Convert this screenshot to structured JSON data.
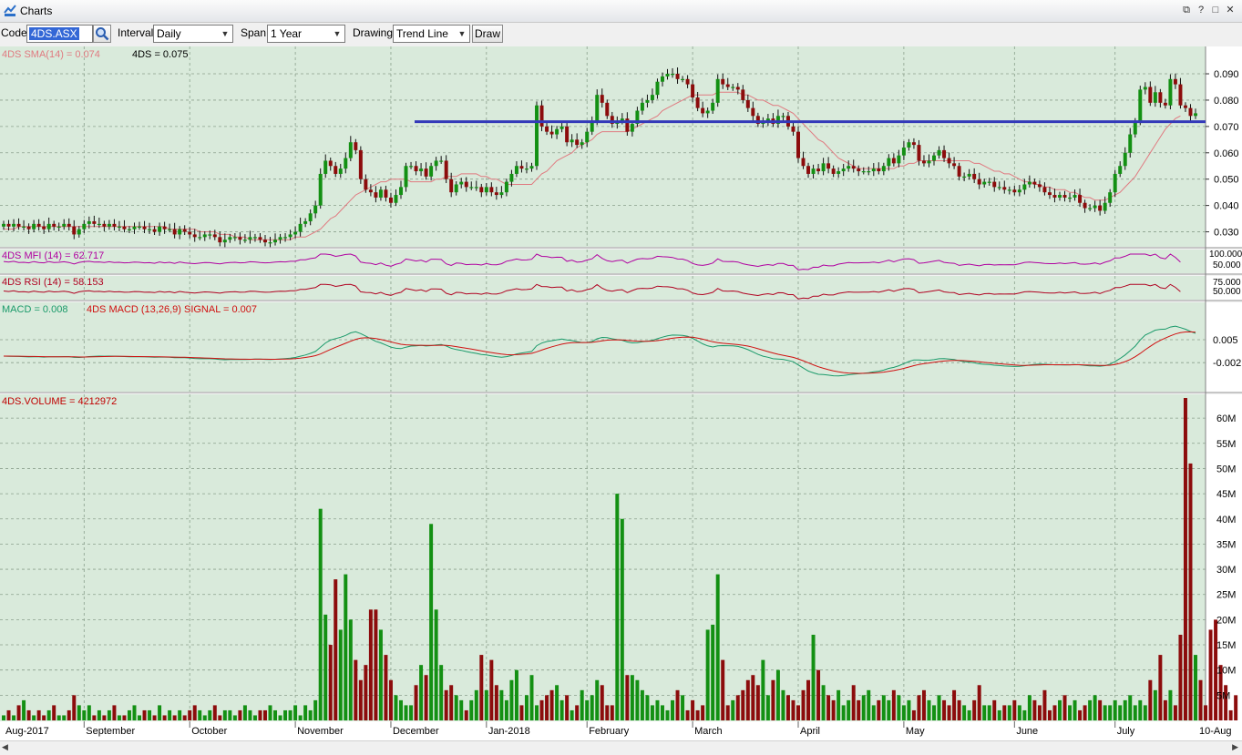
{
  "window": {
    "title": "Charts",
    "controls": [
      "⧉",
      "?",
      "□",
      "✕"
    ]
  },
  "toolbar": {
    "code_label": "Code",
    "code_value": "4DS.ASX",
    "interval_label": "Interval",
    "interval_value": "Daily",
    "span_label": "Span",
    "span_value": "1 Year",
    "drawing_label": "Drawing",
    "drawing_value": "Trend Line",
    "draw_button": "Draw"
  },
  "colors": {
    "panel_bg": "#d9eadb",
    "up": "#139013",
    "down": "#8c0c0c",
    "sma": "#e07a80",
    "trend": "#3339b9",
    "mfi": "#b000a0",
    "rsi": "#b00020",
    "macd": "#1a9a6a",
    "signal": "#d01010"
  },
  "chart_data": {
    "type": "candlestick",
    "symbol": "4DS",
    "price_label": "4DS = 0.075",
    "sma_label": "4DS SMA(14) = 0.074",
    "price_ticks": [
      "0.090",
      "0.080",
      "0.070",
      "0.060",
      "0.050",
      "0.040",
      "0.030"
    ],
    "price_range": [
      0.025,
      0.099
    ],
    "trendline_price": 0.0718,
    "closes": [
      0.033,
      0.032,
      0.033,
      0.032,
      0.032,
      0.031,
      0.033,
      0.032,
      0.031,
      0.033,
      0.032,
      0.032,
      0.033,
      0.032,
      0.029,
      0.031,
      0.033,
      0.034,
      0.033,
      0.033,
      0.032,
      0.033,
      0.032,
      0.032,
      0.031,
      0.031,
      0.032,
      0.032,
      0.031,
      0.031,
      0.03,
      0.032,
      0.031,
      0.031,
      0.029,
      0.031,
      0.03,
      0.029,
      0.028,
      0.028,
      0.029,
      0.029,
      0.028,
      0.026,
      0.027,
      0.028,
      0.028,
      0.027,
      0.027,
      0.028,
      0.028,
      0.027,
      0.026,
      0.026,
      0.027,
      0.028,
      0.028,
      0.029,
      0.03,
      0.033,
      0.034,
      0.037,
      0.04,
      0.052,
      0.057,
      0.055,
      0.052,
      0.054,
      0.058,
      0.064,
      0.061,
      0.05,
      0.046,
      0.045,
      0.043,
      0.046,
      0.043,
      0.041,
      0.044,
      0.047,
      0.055,
      0.055,
      0.053,
      0.054,
      0.051,
      0.055,
      0.057,
      0.057,
      0.05,
      0.045,
      0.048,
      0.049,
      0.047,
      0.047,
      0.047,
      0.045,
      0.047,
      0.045,
      0.044,
      0.045,
      0.049,
      0.052,
      0.055,
      0.054,
      0.054,
      0.055,
      0.078,
      0.07,
      0.068,
      0.067,
      0.069,
      0.07,
      0.064,
      0.065,
      0.063,
      0.064,
      0.068,
      0.072,
      0.082,
      0.079,
      0.074,
      0.071,
      0.072,
      0.073,
      0.068,
      0.071,
      0.076,
      0.079,
      0.08,
      0.082,
      0.087,
      0.089,
      0.09,
      0.09,
      0.088,
      0.088,
      0.086,
      0.081,
      0.077,
      0.075,
      0.076,
      0.079,
      0.088,
      0.086,
      0.085,
      0.085,
      0.084,
      0.08,
      0.077,
      0.074,
      0.071,
      0.072,
      0.073,
      0.071,
      0.074,
      0.074,
      0.07,
      0.068,
      0.058,
      0.055,
      0.052,
      0.054,
      0.053,
      0.056,
      0.054,
      0.052,
      0.053,
      0.054,
      0.055,
      0.054,
      0.053,
      0.053,
      0.053,
      0.054,
      0.053,
      0.055,
      0.058,
      0.056,
      0.059,
      0.062,
      0.064,
      0.063,
      0.057,
      0.056,
      0.057,
      0.059,
      0.061,
      0.058,
      0.056,
      0.055,
      0.051,
      0.051,
      0.052,
      0.05,
      0.048,
      0.049,
      0.049,
      0.047,
      0.047,
      0.046,
      0.046,
      0.045,
      0.046,
      0.048,
      0.049,
      0.048,
      0.047,
      0.045,
      0.044,
      0.043,
      0.044,
      0.043,
      0.043,
      0.044,
      0.041,
      0.039,
      0.039,
      0.04,
      0.038,
      0.041,
      0.045,
      0.052,
      0.055,
      0.06,
      0.067,
      0.072,
      0.084,
      0.085,
      0.079,
      0.083,
      0.079,
      0.078,
      0.088,
      0.086,
      0.078,
      0.077,
      0.074,
      0.075
    ],
    "sma": [
      0.031,
      0.031,
      0.031,
      0.032,
      0.032,
      0.032,
      0.032,
      0.032,
      0.032,
      0.032,
      0.032,
      0.032,
      0.032,
      0.032,
      0.032,
      0.032,
      0.032,
      0.032,
      0.032,
      0.032,
      0.032,
      0.032,
      0.032,
      0.032,
      0.032,
      0.032,
      0.032,
      0.032,
      0.032,
      0.032,
      0.032,
      0.032,
      0.032,
      0.031,
      0.031,
      0.031,
      0.031,
      0.031,
      0.031,
      0.03,
      0.03,
      0.03,
      0.03,
      0.029,
      0.029,
      0.029,
      0.028,
      0.028,
      0.028,
      0.027,
      0.027,
      0.027,
      0.027,
      0.027,
      0.027,
      0.027,
      0.027,
      0.027,
      0.028,
      0.028,
      0.028,
      0.029,
      0.03,
      0.031,
      0.033,
      0.035,
      0.036,
      0.038,
      0.04,
      0.042,
      0.044,
      0.045,
      0.046,
      0.047,
      0.048,
      0.049,
      0.049,
      0.05,
      0.05,
      0.05,
      0.05,
      0.049,
      0.049,
      0.049,
      0.049,
      0.049,
      0.05,
      0.05,
      0.051,
      0.051,
      0.051,
      0.052,
      0.052,
      0.052,
      0.052,
      0.051,
      0.051,
      0.05,
      0.05,
      0.049,
      0.048,
      0.048,
      0.048,
      0.048,
      0.048,
      0.048,
      0.05,
      0.052,
      0.053,
      0.055,
      0.057,
      0.058,
      0.059,
      0.06,
      0.062,
      0.063,
      0.064,
      0.065,
      0.067,
      0.068,
      0.068,
      0.068,
      0.068,
      0.068,
      0.068,
      0.069,
      0.07,
      0.071,
      0.072,
      0.073,
      0.074,
      0.076,
      0.077,
      0.078,
      0.079,
      0.08,
      0.081,
      0.082,
      0.082,
      0.082,
      0.082,
      0.082,
      0.083,
      0.083,
      0.083,
      0.083,
      0.083,
      0.082,
      0.082,
      0.081,
      0.08,
      0.08,
      0.079,
      0.078,
      0.078,
      0.077,
      0.076,
      0.075,
      0.073,
      0.071,
      0.069,
      0.067,
      0.065,
      0.064,
      0.062,
      0.06,
      0.058,
      0.057,
      0.056,
      0.055,
      0.054,
      0.054,
      0.054,
      0.054,
      0.054,
      0.054,
      0.054,
      0.054,
      0.055,
      0.055,
      0.056,
      0.056,
      0.057,
      0.057,
      0.057,
      0.057,
      0.057,
      0.057,
      0.057,
      0.057,
      0.057,
      0.057,
      0.057,
      0.056,
      0.056,
      0.055,
      0.054,
      0.053,
      0.053,
      0.052,
      0.052,
      0.051,
      0.05,
      0.049,
      0.049,
      0.048,
      0.048,
      0.047,
      0.047,
      0.046,
      0.046,
      0.046,
      0.045,
      0.045,
      0.044,
      0.043,
      0.043,
      0.042,
      0.042,
      0.042,
      0.043,
      0.044,
      0.045,
      0.047,
      0.049,
      0.051,
      0.054,
      0.057,
      0.06,
      0.063,
      0.066,
      0.069,
      0.071,
      0.073,
      0.074
    ],
    "months": [
      "Aug-2017",
      "September",
      "October",
      "November",
      "December",
      "Jan-2018",
      "February",
      "March",
      "April",
      "May",
      "June",
      "July",
      "10-Aug"
    ],
    "mfi": {
      "label": "4DS MFI (14) = 62.717",
      "ticks": [
        "100.000",
        "50.000"
      ]
    },
    "rsi": {
      "label": "4DS RSI (14) = 58.153",
      "ticks": [
        "75.000",
        "50.000"
      ]
    },
    "macd": {
      "label": "MACD = 0.008",
      "signal_label": "4DS MACD (13,26,9) SIGNAL = 0.007",
      "ticks": [
        "0.005",
        "-0.002"
      ]
    },
    "volume": {
      "label": "4DS.VOLUME = 4212972",
      "ticks": [
        "60M",
        "55M",
        "50M",
        "45M",
        "40M",
        "35M",
        "30M",
        "25M",
        "20M",
        "15M",
        "10M",
        "5M"
      ],
      "range": [
        0,
        64
      ],
      "values": [
        1,
        2,
        1,
        3,
        4,
        2,
        1,
        2,
        1,
        2,
        3,
        1,
        1,
        2,
        5,
        3,
        2,
        3,
        1,
        2,
        1,
        2,
        3,
        1,
        1,
        2,
        3,
        1,
        2,
        2,
        1,
        3,
        1,
        2,
        1,
        2,
        1,
        2,
        3,
        2,
        1,
        2,
        3,
        1,
        2,
        2,
        1,
        2,
        3,
        2,
        1,
        2,
        2,
        3,
        2,
        1,
        2,
        2,
        3,
        1,
        3,
        2,
        4,
        42,
        21,
        15,
        28,
        18,
        29,
        20,
        12,
        8,
        11,
        22,
        22,
        18,
        13,
        8,
        5,
        4,
        3,
        3,
        7,
        11,
        9,
        39,
        22,
        11,
        6,
        7,
        5,
        4,
        2,
        4,
        6,
        13,
        6,
        12,
        7,
        6,
        4,
        8,
        10,
        3,
        5,
        9,
        3,
        4,
        5,
        6,
        7,
        4,
        5,
        2,
        3,
        6,
        4,
        5,
        8,
        7,
        3,
        3,
        45,
        40,
        9,
        9,
        8,
        6,
        5,
        3,
        4,
        3,
        2,
        4,
        6,
        5,
        2,
        4,
        2,
        3,
        18,
        19,
        29,
        12,
        3,
        4,
        5,
        6,
        8,
        9,
        7,
        12,
        5,
        8,
        10,
        6,
        5,
        4,
        3,
        6,
        8,
        17,
        10,
        7,
        5,
        4,
        6,
        3,
        4,
        7,
        4,
        5,
        6,
        3,
        4,
        5,
        4,
        6,
        5,
        3,
        4,
        2,
        5,
        6,
        4,
        3,
        5,
        4,
        3,
        6,
        4,
        3,
        2,
        4,
        7,
        3,
        3,
        4,
        2,
        3,
        3,
        4,
        3,
        2,
        5,
        4,
        3,
        6,
        2,
        3,
        4,
        5,
        3,
        4,
        2,
        3,
        4,
        5,
        4,
        3,
        3,
        4,
        3,
        4,
        5,
        3,
        4,
        3,
        8,
        6,
        13,
        4,
        6,
        3,
        17,
        64,
        51,
        13,
        8,
        3,
        18,
        20,
        11,
        7,
        2,
        5
      ]
    }
  }
}
